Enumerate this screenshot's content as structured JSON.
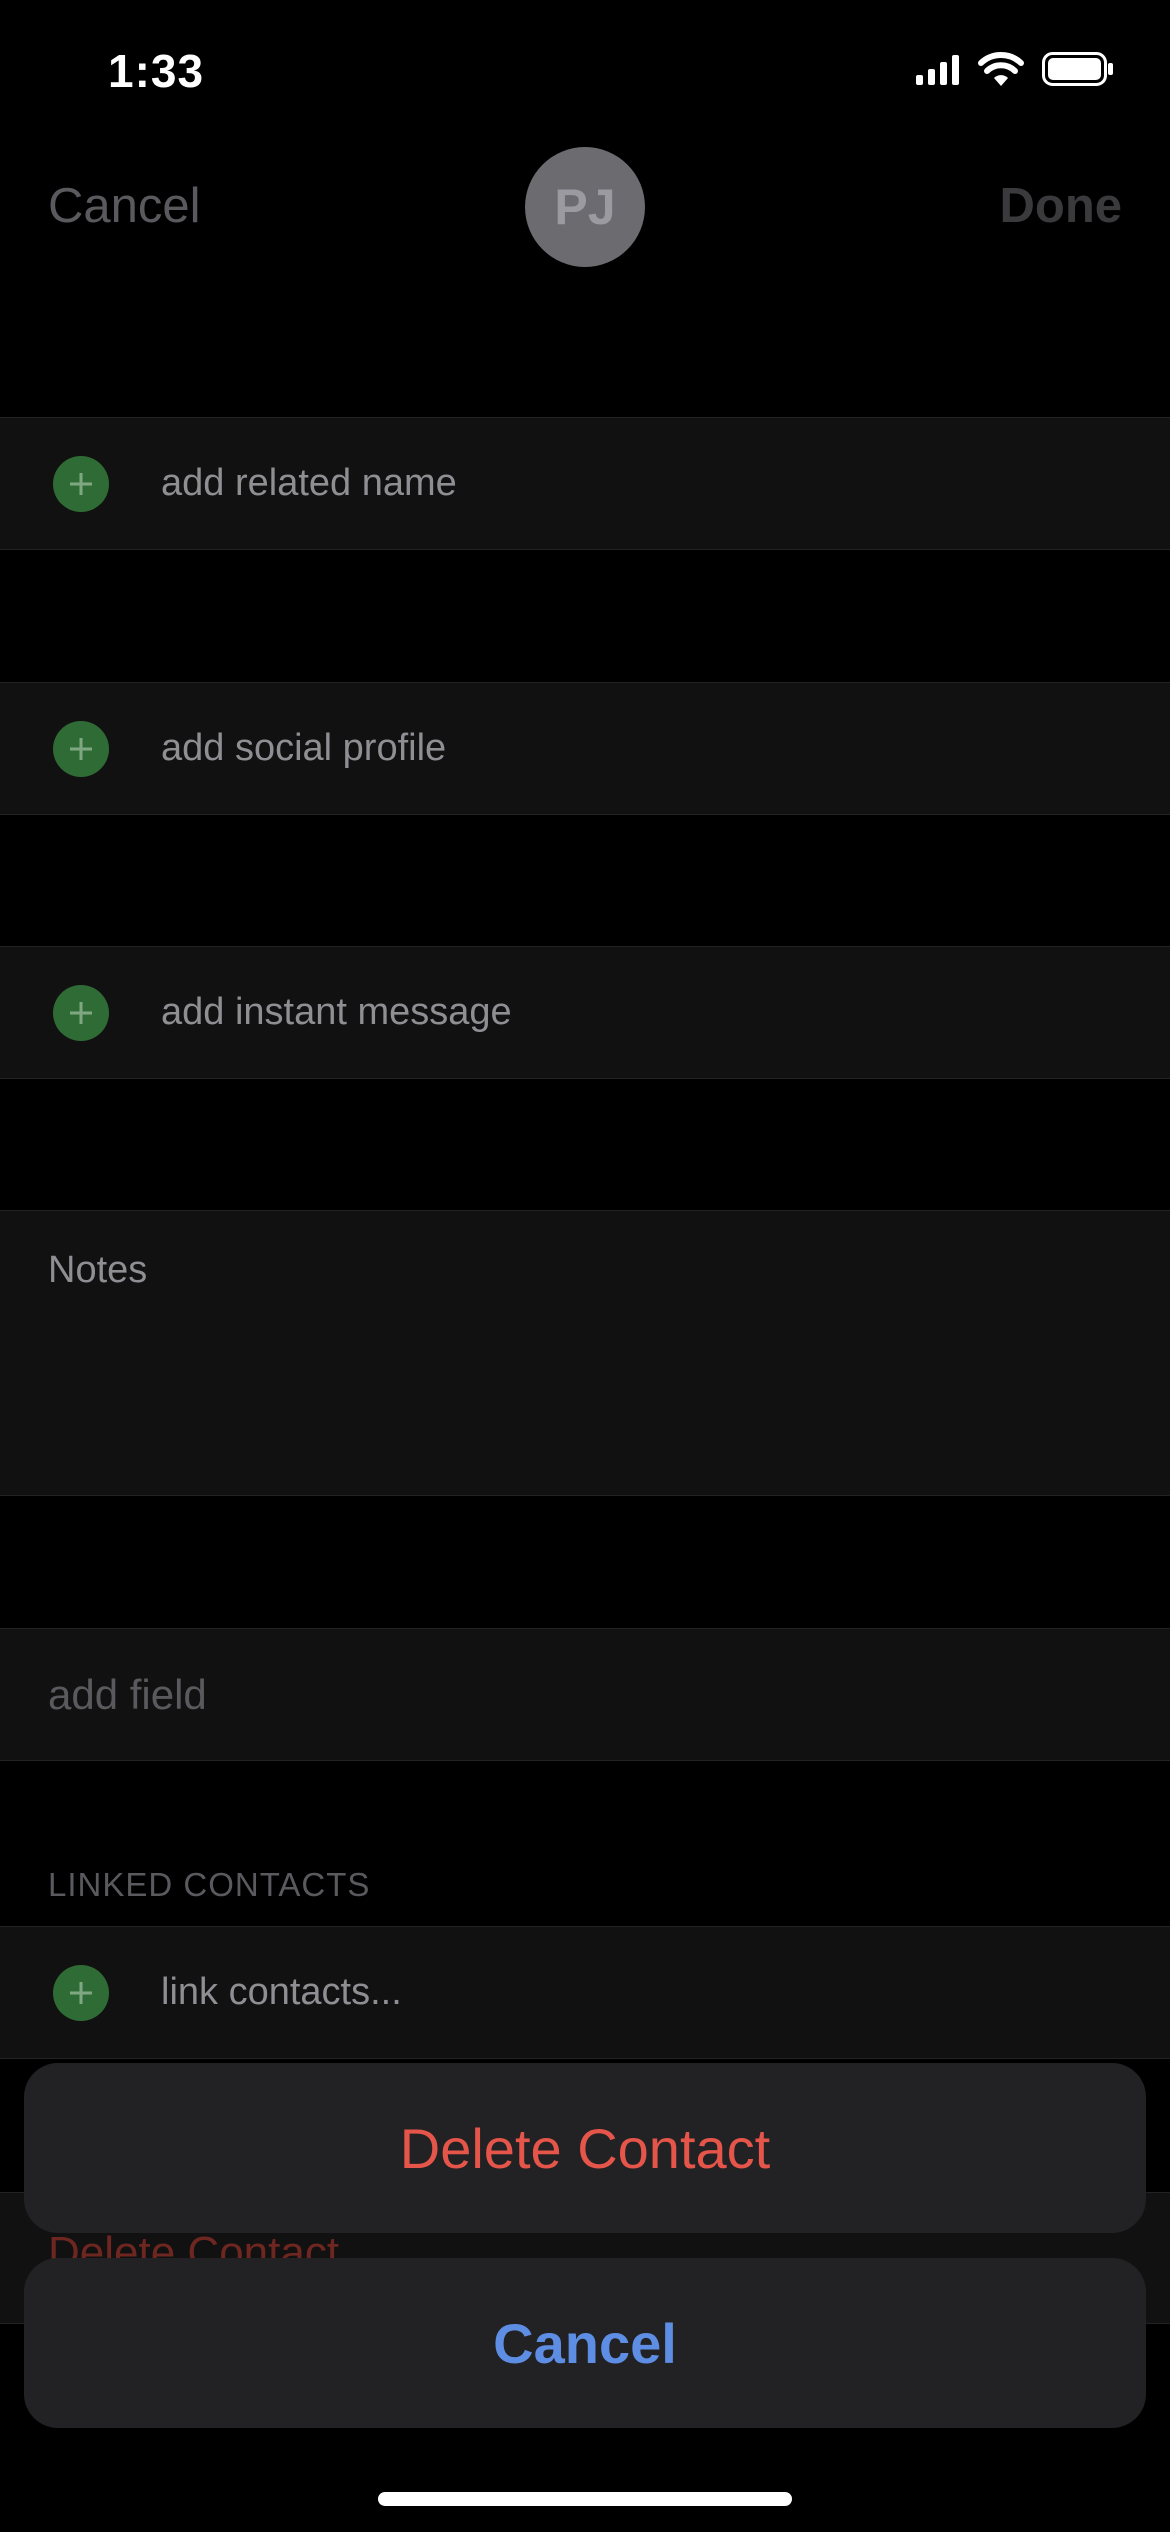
{
  "status_bar": {
    "time": "1:33"
  },
  "nav": {
    "cancel_label": "Cancel",
    "done_label": "Done",
    "avatar_initials": "PJ"
  },
  "rows": {
    "related_name": "add related name",
    "social_profile": "add social profile",
    "instant_message": "add instant message",
    "notes_label": "Notes",
    "add_field": "add field",
    "linked_contacts_header": "LINKED CONTACTS",
    "link_contacts": "link contacts...",
    "delete_contact_behind": "Delete Contact"
  },
  "action_sheet": {
    "delete_label": "Delete Contact",
    "cancel_label": "Cancel"
  },
  "colors": {
    "destructive": "#e5554a",
    "accent": "#5e8ee4",
    "add_green": "#2f6c35"
  }
}
